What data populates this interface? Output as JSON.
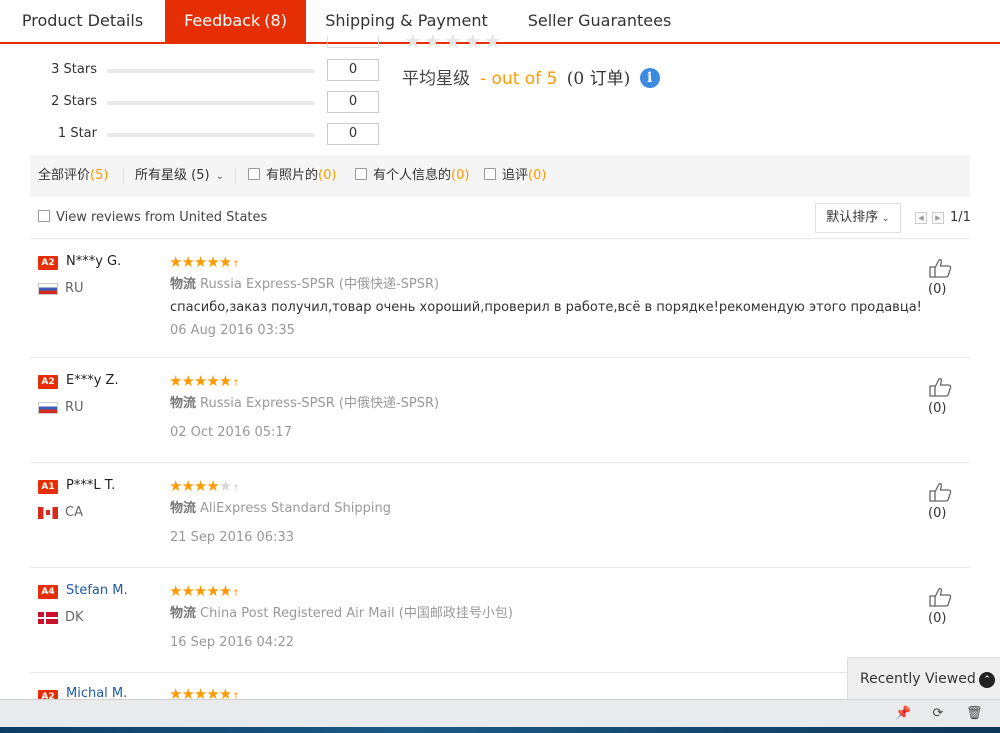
{
  "tabs": [
    {
      "label": "Product Details",
      "count": ""
    },
    {
      "label": "Feedback",
      "count": "(8)"
    },
    {
      "label": "Shipping & Payment",
      "count": ""
    },
    {
      "label": "Seller Guarantees",
      "count": ""
    }
  ],
  "faint_stars": "★★★★★",
  "rating_breakdown": [
    {
      "label": "3 Stars",
      "count": "0"
    },
    {
      "label": "2 Stars",
      "count": "0"
    },
    {
      "label": "1 Star",
      "count": "0"
    }
  ],
  "average": {
    "label": "平均星级",
    "score_text": "- out of 5",
    "orders_text": "(0 订单)",
    "info_glyph": "i"
  },
  "filters": {
    "all": {
      "label": "全部评价",
      "count": "(5)"
    },
    "stars": {
      "label": "所有星级",
      "count": "(5)",
      "chevron": "⌄"
    },
    "photos": {
      "label": "有照片的",
      "count": "(0)"
    },
    "personal": {
      "label": "有个人信息的",
      "count": "(0)"
    },
    "followup": {
      "label": "追评",
      "count": "(0)"
    }
  },
  "view_us_label": "View reviews from United States",
  "sort_label": "默认排序",
  "sort_chevron": "⌄",
  "pager": {
    "prev": "◀",
    "next": "▶",
    "text": "1/1"
  },
  "shipping_label": "物流",
  "reviews": [
    {
      "level": "A2",
      "name": "N***y G.",
      "country": "RU",
      "stars": 5,
      "shipping": "Russia Express-SPSR (中俄快递-SPSR)",
      "text": "спасибо,заказ получил,товар очень хороший,проверил в работе,всё в порядке!рекомендую этого продавца!",
      "date": "06 Aug 2016 03:35",
      "likes": "(0)"
    },
    {
      "level": "A2",
      "name": "E***y Z.",
      "country": "RU",
      "stars": 5,
      "shipping": "Russia Express-SPSR (中俄快递-SPSR)",
      "text": "",
      "date": "02 Oct 2016 05:17",
      "likes": "(0)"
    },
    {
      "level": "A1",
      "name": "P***L T.",
      "country": "CA",
      "stars": 4,
      "shipping": "AliExpress Standard Shipping",
      "text": "",
      "date": "21 Sep 2016 06:33",
      "likes": "(0)"
    },
    {
      "level": "A4",
      "name": "Stefan M.",
      "country": "DK",
      "stars": 5,
      "shipping": "China Post Registered Air Mail (中国邮政挂号小包)",
      "text": "",
      "date": "16 Sep 2016 04:22",
      "likes": "(0)"
    },
    {
      "level": "A2",
      "name": "Michal M.",
      "country": "",
      "stars": 5,
      "shipping": "",
      "text": "",
      "date": "",
      "likes": ""
    }
  ],
  "star_glyph": "★★★★★",
  "star_full4": "★★★★",
  "star_off1": "★",
  "star_tail": "↑",
  "recently_viewed": {
    "label": "Recently Viewed",
    "glyph": "⌃"
  },
  "bottom_icons": {
    "pin": "📌",
    "refresh": "⟳",
    "trash": "🗑"
  },
  "colors": {
    "accent": "#e62e04",
    "star": "#ff9900",
    "link": "#1e5aa8"
  }
}
